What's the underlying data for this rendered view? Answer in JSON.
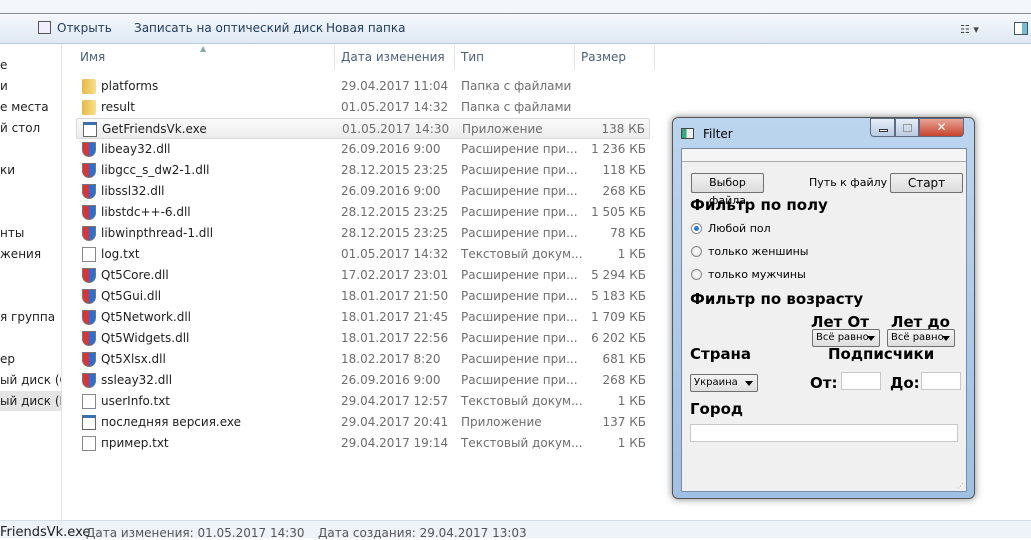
{
  "toolbar": {
    "open": "Открыть",
    "burn": "Записать на оптический диск",
    "new_folder": "Новая папка"
  },
  "sidebar": {
    "items": [
      "е",
      "и",
      "е места",
      "й стол",
      "ки",
      "нты",
      "жения",
      "я группа",
      "ер",
      "ый диск (C",
      "ый диск (E:"
    ]
  },
  "columns": {
    "name": "Имя",
    "date": "Дата изменения",
    "type": "Тип",
    "size": "Размер"
  },
  "files": [
    {
      "name": "platforms",
      "date": "29.04.2017 11:04",
      "type": "Папка с файлами",
      "size": "",
      "icon": "folder"
    },
    {
      "name": "result",
      "date": "01.05.2017 14:32",
      "type": "Папка с файлами",
      "size": "",
      "icon": "folder"
    },
    {
      "name": "GetFriendsVk.exe",
      "date": "01.05.2017 14:30",
      "type": "Приложение",
      "size": "138 КБ",
      "icon": "exe"
    },
    {
      "name": "libeay32.dll",
      "date": "26.09.2016 9:00",
      "type": "Расширение при...",
      "size": "1 236 КБ",
      "icon": "shield"
    },
    {
      "name": "libgcc_s_dw2-1.dll",
      "date": "28.12.2015 23:25",
      "type": "Расширение при...",
      "size": "118 КБ",
      "icon": "shield"
    },
    {
      "name": "libssl32.dll",
      "date": "26.09.2016 9:00",
      "type": "Расширение при...",
      "size": "268 КБ",
      "icon": "shield"
    },
    {
      "name": "libstdc++-6.dll",
      "date": "28.12.2015 23:25",
      "type": "Расширение при...",
      "size": "1 505 КБ",
      "icon": "shield"
    },
    {
      "name": "libwinpthread-1.dll",
      "date": "28.12.2015 23:25",
      "type": "Расширение при...",
      "size": "78 КБ",
      "icon": "shield"
    },
    {
      "name": "log.txt",
      "date": "01.05.2017 14:32",
      "type": "Текстовый докум...",
      "size": "1 КБ",
      "icon": "txt"
    },
    {
      "name": "Qt5Core.dll",
      "date": "17.02.2017 23:01",
      "type": "Расширение при...",
      "size": "5 294 КБ",
      "icon": "shield"
    },
    {
      "name": "Qt5Gui.dll",
      "date": "18.01.2017 21:50",
      "type": "Расширение при...",
      "size": "5 183 КБ",
      "icon": "shield"
    },
    {
      "name": "Qt5Network.dll",
      "date": "18.01.2017 21:45",
      "type": "Расширение при...",
      "size": "1 709 КБ",
      "icon": "shield"
    },
    {
      "name": "Qt5Widgets.dll",
      "date": "18.01.2017 22:56",
      "type": "Расширение при...",
      "size": "6 202 КБ",
      "icon": "shield"
    },
    {
      "name": "Qt5Xlsx.dll",
      "date": "18.02.2017 8:20",
      "type": "Расширение при...",
      "size": "681 КБ",
      "icon": "shield"
    },
    {
      "name": "ssleay32.dll",
      "date": "26.09.2016 9:00",
      "type": "Расширение при...",
      "size": "268 КБ",
      "icon": "shield"
    },
    {
      "name": "userInfo.txt",
      "date": "29.04.2017 12:57",
      "type": "Текстовый докум...",
      "size": "1 КБ",
      "icon": "txt"
    },
    {
      "name": "последняя версия.exe",
      "date": "29.04.2017 20:41",
      "type": "Приложение",
      "size": "137 КБ",
      "icon": "exe"
    },
    {
      "name": "пример.txt",
      "date": "29.04.2017 19:14",
      "type": "Текстовый докум...",
      "size": "1 КБ",
      "icon": "txt"
    }
  ],
  "status": {
    "name": "FriendsVk.exe",
    "modified": "Дата изменения: 01.05.2017 14:30",
    "created": "Дата создания: 29.04.2017 13:03"
  },
  "filter": {
    "title": "Filter",
    "choose_file": "Выбор файла",
    "path_label": "Путь к файлу",
    "start": "Старт",
    "gender_heading": "Фильтр по полу",
    "gender_options": [
      "Любой пол",
      "только женшины",
      "только мужчины"
    ],
    "gender_selected": 0,
    "age_heading": "Фильтр по возрасту",
    "age_from_label": "Лет От",
    "age_to_label": "Лет до",
    "age_from_value": "Всё равно",
    "age_to_value": "Всё равно",
    "country_label": "Страна",
    "country_value": "Украина",
    "subs_label": "Подписчики",
    "subs_from_label": "От:",
    "subs_to_label": "До:",
    "subs_from": "",
    "subs_to": "",
    "city_label": "Город",
    "city_value": ""
  }
}
